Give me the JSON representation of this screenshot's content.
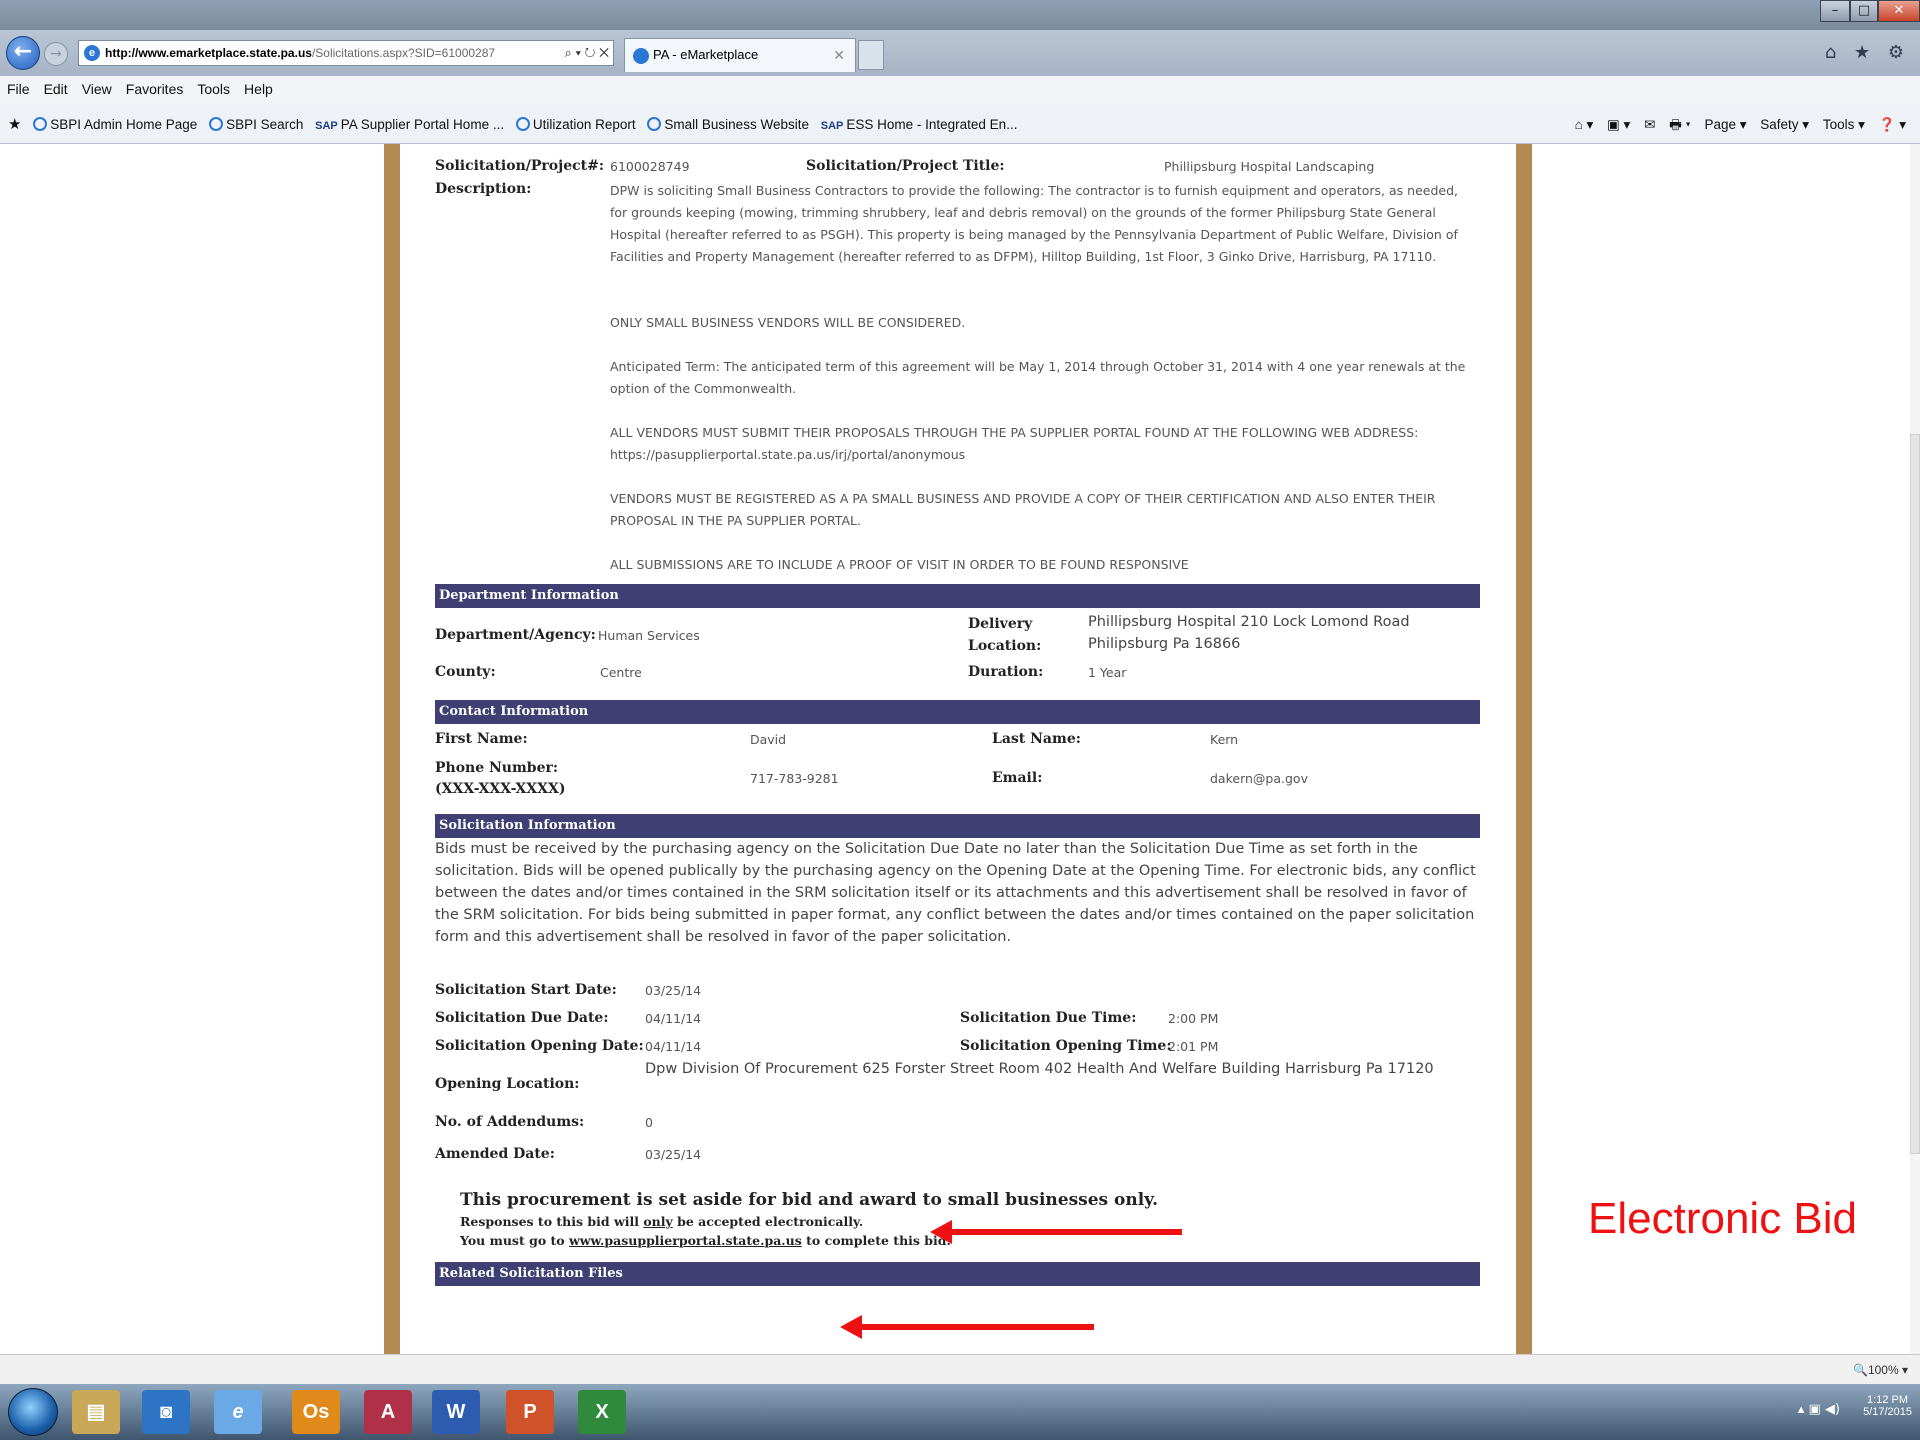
{
  "browser": {
    "url_domain": "http://www.emarketplace.state.pa.us",
    "url_rest": "/Solicitations.aspx?SID=61000287",
    "url_tools": "⌕ ▾ ↻ ✕",
    "tab_title": "PA - eMarketplace",
    "tab_close": "✕",
    "right_icons": "⌂ ★ ⚙",
    "menu": [
      "File",
      "Edit",
      "View",
      "Favorites",
      "Tools",
      "Help"
    ],
    "favorites": [
      {
        "icon": "ie",
        "label": "SBPI Admin Home Page"
      },
      {
        "icon": "ie",
        "label": "SBPI Search"
      },
      {
        "icon": "sap",
        "label": "PA Supplier Portal Home ..."
      },
      {
        "icon": "ie",
        "label": "Utilization Report"
      },
      {
        "icon": "ie",
        "label": "Small Business Website"
      },
      {
        "icon": "sap",
        "label": "ESS Home - Integrated En..."
      }
    ],
    "command_bar": [
      "⌂ ▾",
      "▣ ▾",
      "✉",
      "🖶 ▾",
      "Page ▾",
      "Safety ▾",
      "Tools ▾",
      "❓ ▾"
    ],
    "zoom": "🔍100%  ▾"
  },
  "solicitation": {
    "number_label": "Solicitation/Project#:",
    "number": "6100028749",
    "title_label": "Solicitation/Project Title:",
    "title": "Phillipsburg Hospital Landscaping",
    "description_label": "Description:",
    "description": [
      "DPW is soliciting Small Business Contractors to provide the following: The contractor is to furnish equipment and operators, as needed, for grounds keeping (mowing, trimming shrubbery, leaf and debris removal) on the grounds of the former Philipsburg State General Hospital (hereafter referred to as PSGH).  This property is being managed by the Pennsylvania Department of Public Welfare, Division of Facilities and Property Management (hereafter referred to as DFPM), Hilltop Building, 1st Floor, 3 Ginko Drive, Harrisburg, PA 17110.",
      "ONLY SMALL BUSINESS VENDORS WILL BE CONSIDERED.",
      "Anticipated Term: The anticipated term of this agreement will be May 1, 2014 through October 31, 2014 with 4 one year renewals at the option of the Commonwealth.",
      "ALL VENDORS MUST SUBMIT THEIR PROPOSALS THROUGH THE PA SUPPLIER PORTAL FOUND AT THE FOLLOWING WEB ADDRESS: https://pasupplierportal.state.pa.us/irj/portal/anonymous",
      "VENDORS MUST BE REGISTERED AS A PA SMALL BUSINESS AND PROVIDE A COPY OF THEIR CERTIFICATION AND ALSO ENTER THEIR PROPOSAL IN THE  PA SUPPLIER PORTAL.",
      "ALL SUBMISSIONS ARE TO INCLUDE A PROOF OF VISIT IN ORDER TO BE FOUND RESPONSIVE"
    ]
  },
  "department": {
    "header": "Department Information",
    "agency_label": "Department/Agency:",
    "agency": "Human Services",
    "delivery_label_1": "Delivery",
    "delivery_label_2": "Location:",
    "delivery_1": "Phillipsburg Hospital    210 Lock Lomond Road",
    "delivery_2": "Philipsburg  Pa 16866",
    "county_label": "County:",
    "county": "Centre",
    "duration_label": "Duration:",
    "duration": "1 Year"
  },
  "contact": {
    "header": "Contact Information",
    "first_label": "First Name:",
    "first": "David",
    "last_label": "Last Name:",
    "last": "Kern",
    "phone_label_1": "Phone Number:",
    "phone_label_2": "(XXX-XXX-XXXX)",
    "phone": "717-783-9281",
    "email_label": "Email:",
    "email": "dakern@pa.gov"
  },
  "solicitation_info": {
    "header": "Solicitation Information",
    "text": "Bids must be received by the purchasing agency on the Solicitation Due Date no later than the Solicitation Due Time as set forth in the solicitation. Bids will be opened publically by the purchasing agency on the Opening Date at the Opening Time. For electronic bids, any conflict between the dates and/or times contained in the SRM solicitation itself or its attachments and this advertisement shall be resolved in favor of the SRM solicitation. For bids being submitted in paper format, any conflict between the dates and/or times contained on the paper solicitation form and this advertisement shall be resolved in favor of the paper solicitation.",
    "start_label": "Solicitation Start Date:",
    "start": "03/25/14",
    "due_label": "Solicitation Due Date:",
    "due": "04/11/14",
    "due_time_label": "Solicitation Due Time:",
    "due_time": "2:00 PM",
    "opening_label": "Solicitation Opening Date:",
    "opening": "04/11/14",
    "opening_time_label": "Solicitation Opening Time:",
    "opening_time": "2:01 PM",
    "location_label": "Opening Location:",
    "location": "Dpw Division Of Procurement 625 Forster Street  Room 402 Health And Welfare Building  Harrisburg Pa 17120",
    "addenda_label": "No. of Addendums:",
    "addenda": "0",
    "amended_label": "Amended Date:",
    "amended": "03/25/14"
  },
  "notice": {
    "line1": "This procurement is set aside for bid and award to small businesses only.",
    "line2_a": "Responses to this bid will ",
    "line2_b": "only",
    "line2_c": " be accepted electronically.",
    "line3_a": "You must go to ",
    "line3_link": "www.pasupplierportal.state.pa.us",
    "line3_b": " to complete this bid."
  },
  "files_header": "Related Solicitation Files",
  "annotation": "Electronic Bid",
  "taskbar": {
    "apps": [
      "▤",
      "◙",
      "e",
      "Os",
      "A",
      "W",
      "P",
      "X"
    ],
    "time": "1:12 PM",
    "date": "5/17/2015",
    "tray": "▴  ▣  ◀)"
  },
  "colors": {
    "section": "#3f3f73",
    "border": "#b48a54",
    "annotation": "#ee1111"
  }
}
